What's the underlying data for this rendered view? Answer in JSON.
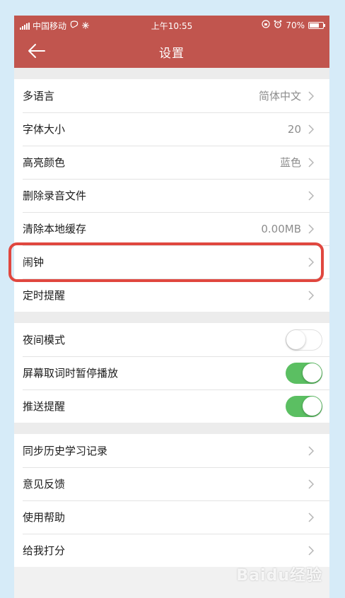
{
  "status_bar": {
    "carrier": "中国移动",
    "time": "上午10:55",
    "battery": "70%",
    "battery_level": 0.7
  },
  "header": {
    "title": "设置"
  },
  "groups": [
    {
      "items": [
        {
          "label": "多语言",
          "value": "简体中文"
        },
        {
          "label": "字体大小",
          "value": "20"
        },
        {
          "label": "高亮颜色",
          "value": "蓝色"
        },
        {
          "label": "删除录音文件",
          "value": ""
        },
        {
          "label": "清除本地缓存",
          "value": "0.00MB"
        },
        {
          "label": "闹钟",
          "value": ""
        },
        {
          "label": "定时提醒",
          "value": ""
        }
      ]
    },
    {
      "items": [
        {
          "label": "夜间模式",
          "toggle": false
        },
        {
          "label": "屏幕取词时暂停播放",
          "toggle": true
        },
        {
          "label": "推送提醒",
          "toggle": true
        }
      ]
    },
    {
      "items": [
        {
          "label": "同步历史学习记录"
        },
        {
          "label": "意见反馈"
        },
        {
          "label": "使用帮助"
        },
        {
          "label": "给我打分"
        }
      ]
    }
  ],
  "colors": {
    "header": "#c1554e",
    "toggle_on": "#5bbf62",
    "highlight_box": "#e0473f",
    "background": "#d6ebf8"
  },
  "watermark": "Baidu经验"
}
